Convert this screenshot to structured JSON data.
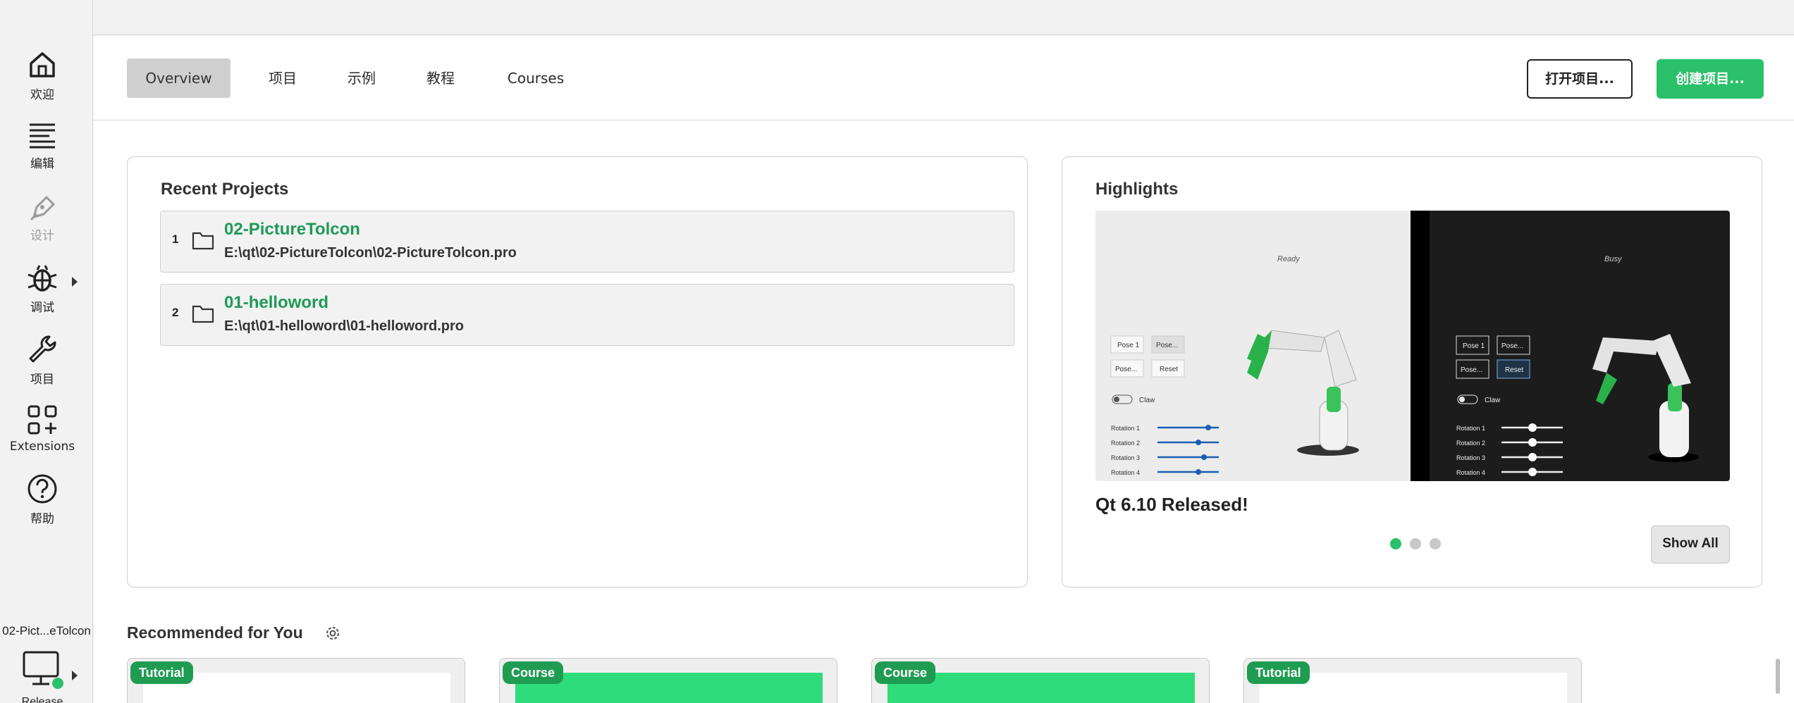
{
  "sidebar": {
    "items": [
      {
        "label": "欢迎",
        "icon": "home-icon"
      },
      {
        "label": "编辑",
        "icon": "edit-lines-icon"
      },
      {
        "label": "设计",
        "icon": "pen-icon"
      },
      {
        "label": "调试",
        "icon": "bug-icon"
      },
      {
        "label": "项目",
        "icon": "wrench-icon"
      },
      {
        "label": "Extensions",
        "icon": "extensions-icon"
      },
      {
        "label": "帮助",
        "icon": "help-icon"
      }
    ],
    "project_name": "02-Pict...eTolcon",
    "run_config": "Release"
  },
  "tabs": [
    {
      "label": "Overview"
    },
    {
      "label": "项目"
    },
    {
      "label": "示例"
    },
    {
      "label": "教程"
    },
    {
      "label": "Courses"
    }
  ],
  "actions": {
    "open_label": "打开项目...",
    "create_label": "创建项目..."
  },
  "recent": {
    "title": "Recent Projects",
    "items": [
      {
        "num": "1",
        "name": "02-PictureTolcon",
        "path": "E:\\qt\\02-PictureTolcon\\02-PictureTolcon.pro"
      },
      {
        "num": "2",
        "name": "01-helloword",
        "path": "E:\\qt\\01-helloword\\01-helloword.pro"
      }
    ]
  },
  "highlights": {
    "title": "Highlights",
    "caption": "Qt 6.10 Released!",
    "show_all": "Show All",
    "active_dot": 0,
    "image": {
      "left_state": "Ready",
      "right_state": "Busy",
      "pose1": "Pose 1",
      "pose_more": "Pose...",
      "reset": "Reset",
      "claw": "Claw",
      "rotations": [
        "Rotation 1",
        "Rotation 2",
        "Rotation 3",
        "Rotation 4"
      ]
    }
  },
  "recommended": {
    "title": "Recommended for You",
    "cards": [
      {
        "badge": "Tutorial"
      },
      {
        "badge": "Course"
      },
      {
        "badge": "Course"
      },
      {
        "badge": "Tutorial"
      }
    ]
  },
  "colors": {
    "accent": "#2bc06a",
    "project_link": "#1e9a58",
    "badge": "#1f9c52"
  }
}
